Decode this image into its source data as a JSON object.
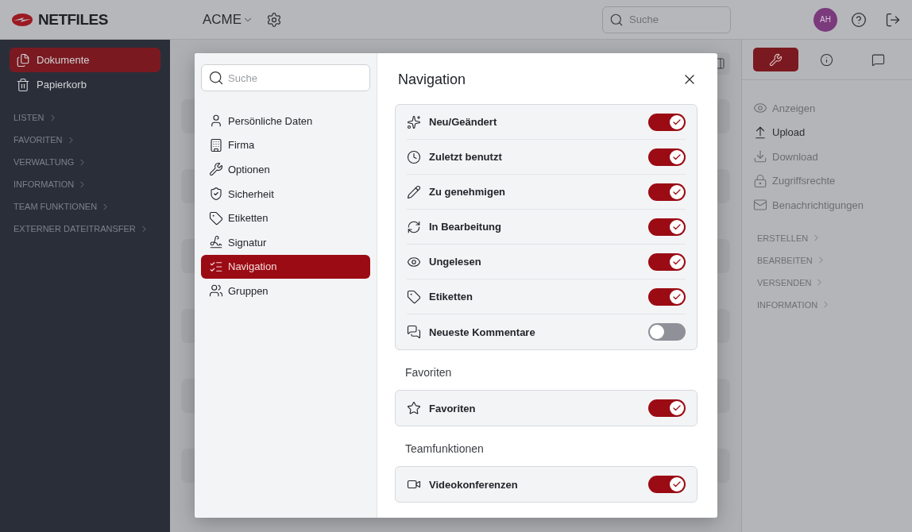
{
  "header": {
    "logo": "NETFILES",
    "organization": "ACME",
    "search": {
      "placeholder": "Suche"
    },
    "avatar": "AH"
  },
  "sidebar": {
    "items": [
      {
        "label": "Dokumente",
        "kind": "documents",
        "selected": true
      },
      {
        "label": "Papierkorb",
        "kind": "trash",
        "selected": false
      }
    ],
    "sections": [
      "LISTEN",
      "FAVORITEN",
      "VERWALTUNG",
      "INFORMATION",
      "TEAM FUNKTIONEN",
      "EXTERNER DATEITRANSFER"
    ]
  },
  "right_panel": {
    "tabs": [
      {
        "kind": "tools",
        "selected": true
      },
      {
        "kind": "info",
        "selected": false
      },
      {
        "kind": "comments",
        "selected": false
      }
    ],
    "actions": [
      {
        "label": "Anzeigen",
        "kind": "view",
        "disabled": true
      },
      {
        "label": "Upload",
        "kind": "upload",
        "disabled": false
      },
      {
        "label": "Download",
        "kind": "download",
        "disabled": true
      },
      {
        "label": "Zugriffsrechte",
        "kind": "lock",
        "disabled": true
      },
      {
        "label": "Benachrichtigungen",
        "kind": "mail",
        "disabled": true
      }
    ],
    "sections": [
      "ERSTELLEN",
      "BEARBEITEN",
      "VERSENDEN",
      "INFORMATION"
    ]
  },
  "dialog": {
    "search": {
      "placeholder": "Suche"
    },
    "menu": [
      {
        "label": "Persönliche Daten",
        "kind": "user",
        "selected": false
      },
      {
        "label": "Firma",
        "kind": "building",
        "selected": false
      },
      {
        "label": "Optionen",
        "kind": "wrench",
        "selected": false
      },
      {
        "label": "Sicherheit",
        "kind": "shield",
        "selected": false
      },
      {
        "label": "Etiketten",
        "kind": "tag",
        "selected": false
      },
      {
        "label": "Signatur",
        "kind": "signature",
        "selected": false
      },
      {
        "label": "Navigation",
        "kind": "list",
        "selected": true
      },
      {
        "label": "Gruppen",
        "kind": "users",
        "selected": false
      }
    ],
    "title": "Navigation",
    "groups": [
      {
        "items": [
          {
            "label": "Neu/Geändert",
            "kind": "sparkles",
            "on": true
          },
          {
            "label": "Zuletzt benutzt",
            "kind": "clock",
            "on": true
          },
          {
            "label": "Zu genehmigen",
            "kind": "pencil",
            "on": true
          },
          {
            "label": "In Bearbeitung",
            "kind": "refresh",
            "on": true
          },
          {
            "label": "Ungelesen",
            "kind": "eye",
            "on": true
          },
          {
            "label": "Etiketten",
            "kind": "tag",
            "on": true
          },
          {
            "label": "Neueste Kommentare",
            "kind": "comments",
            "on": false
          }
        ]
      },
      {
        "heading": "Favoriten",
        "items": [
          {
            "label": "Favoriten",
            "kind": "star",
            "on": true
          }
        ]
      },
      {
        "heading": "Teamfunktionen",
        "items": [
          {
            "label": "Videokonferenzen",
            "kind": "video",
            "on": true
          }
        ]
      }
    ]
  }
}
